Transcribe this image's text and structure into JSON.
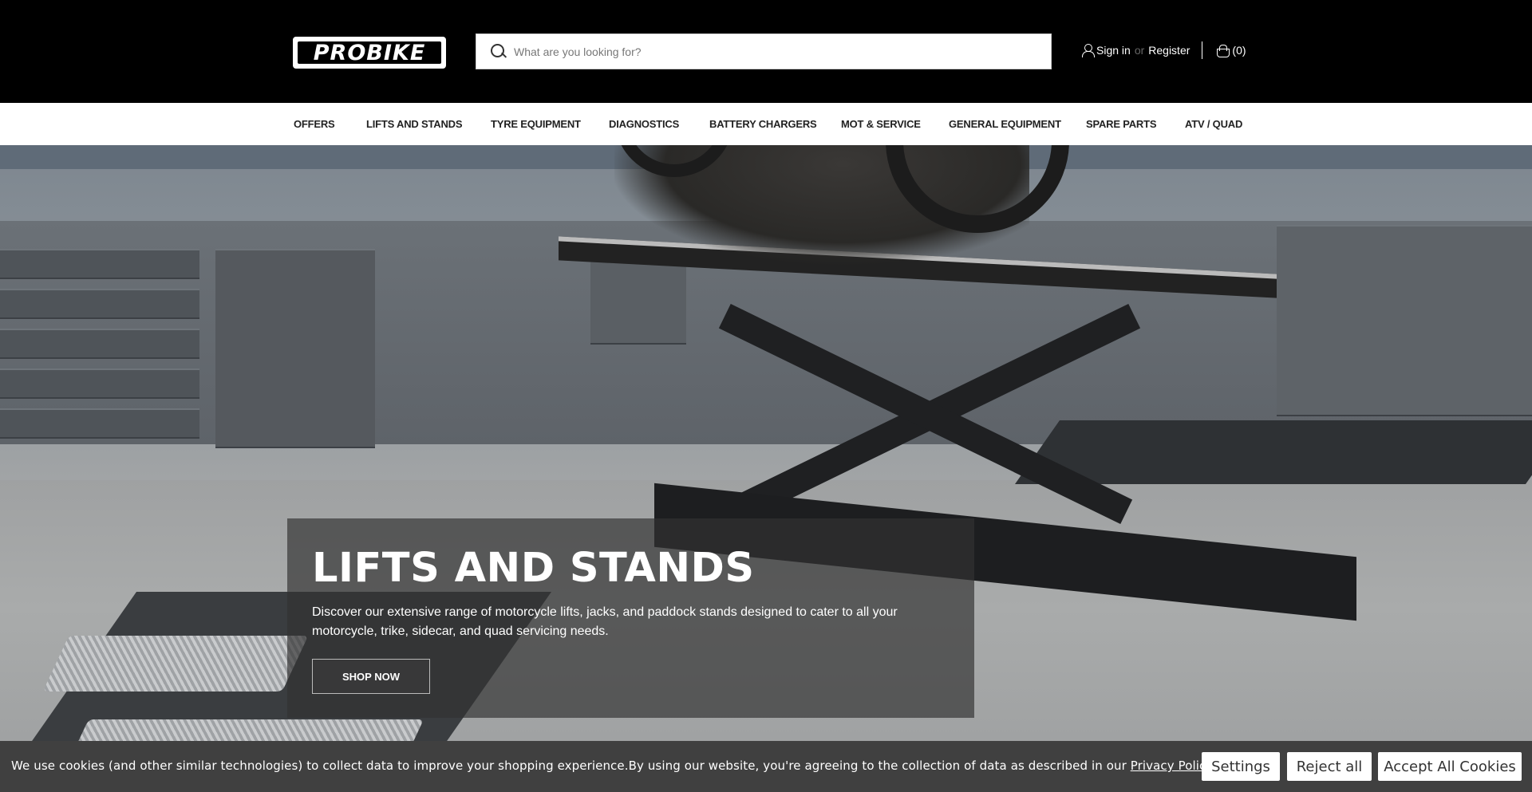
{
  "header": {
    "logo_text": "PROBIKE",
    "search_placeholder": "What are you looking for?",
    "sign_in": "Sign in",
    "or": "or",
    "register": "Register",
    "cart": "(0)"
  },
  "nav": {
    "items": [
      "OFFERS",
      "LIFTS AND STANDS",
      "TYRE EQUIPMENT",
      "DIAGNOSTICS",
      "BATTERY CHARGERS",
      "MOT & SERVICE",
      "GENERAL EQUIPMENT",
      "SPARE PARTS",
      "ATV / QUAD"
    ]
  },
  "hero": {
    "title": "LIFTS AND STANDS",
    "text": "Discover our extensive range of motorcycle lifts, jacks, and paddock stands designed to cater to all your motorcycle, trike, sidecar, and quad servicing needs.",
    "button": "SHOP NOW"
  },
  "cookie": {
    "text": "We use cookies (and other similar technologies) to collect data to improve your shopping experience.By using our website, you're agreeing to the collection of data as described in our ",
    "link": "Privacy Policy",
    "period": ".",
    "settings": "Settings",
    "reject": "Reject all",
    "accept": "Accept All Cookies"
  },
  "colors": {
    "header_bg": "#000000",
    "nav_bg": "#ffffff",
    "cookie_bg": "#404040"
  }
}
